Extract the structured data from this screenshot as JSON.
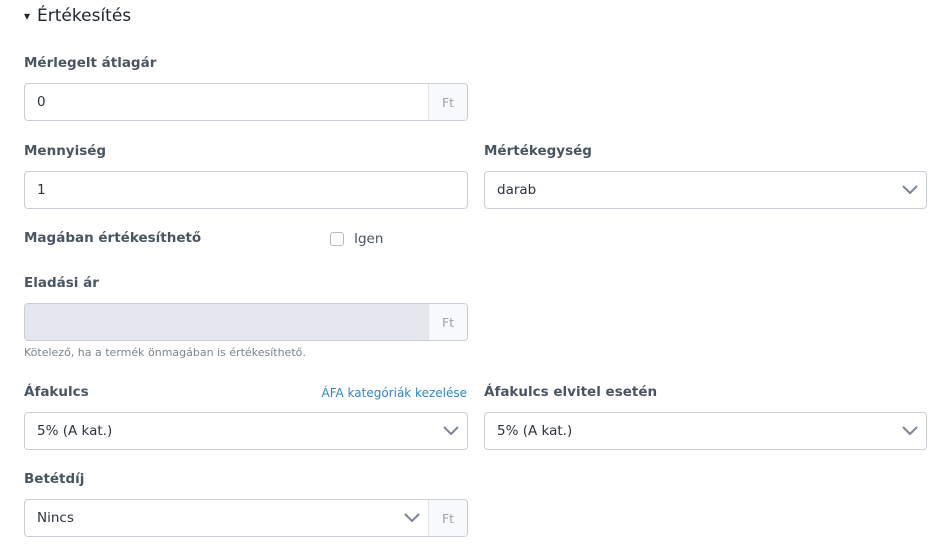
{
  "section": {
    "title": "Értékesítés",
    "toggle": "▾"
  },
  "weighted_avg_price": {
    "label": "Mérlegelt átlagár",
    "value": "0",
    "suffix": "Ft"
  },
  "quantity": {
    "label": "Mennyiség",
    "value": "1"
  },
  "unit": {
    "label": "Mértékegység",
    "selected": "darab"
  },
  "sellable_alone": {
    "label": "Magában értékesíthető",
    "checkbox_label": "Igen",
    "checked": false
  },
  "sale_price": {
    "label": "Eladási ár",
    "value": "",
    "suffix": "Ft",
    "hint": "Kötelező, ha a termék önmagában is értékesíthető."
  },
  "vat_rate": {
    "label": "Áfakulcs",
    "link": "ÁFA kategóriák kezelése",
    "selected": "5% (A kat.)"
  },
  "vat_rate_takeaway": {
    "label": "Áfakulcs elvitel esetén",
    "selected": "5% (A kat.)"
  },
  "deposit_fee": {
    "label": "Betétdíj",
    "selected": "Nincs",
    "suffix": "Ft"
  },
  "colors": {
    "link": "#2f86c8",
    "border": "#c9cfd7",
    "disabled_bg": "#e4e7ed",
    "label": "#4a5563"
  }
}
